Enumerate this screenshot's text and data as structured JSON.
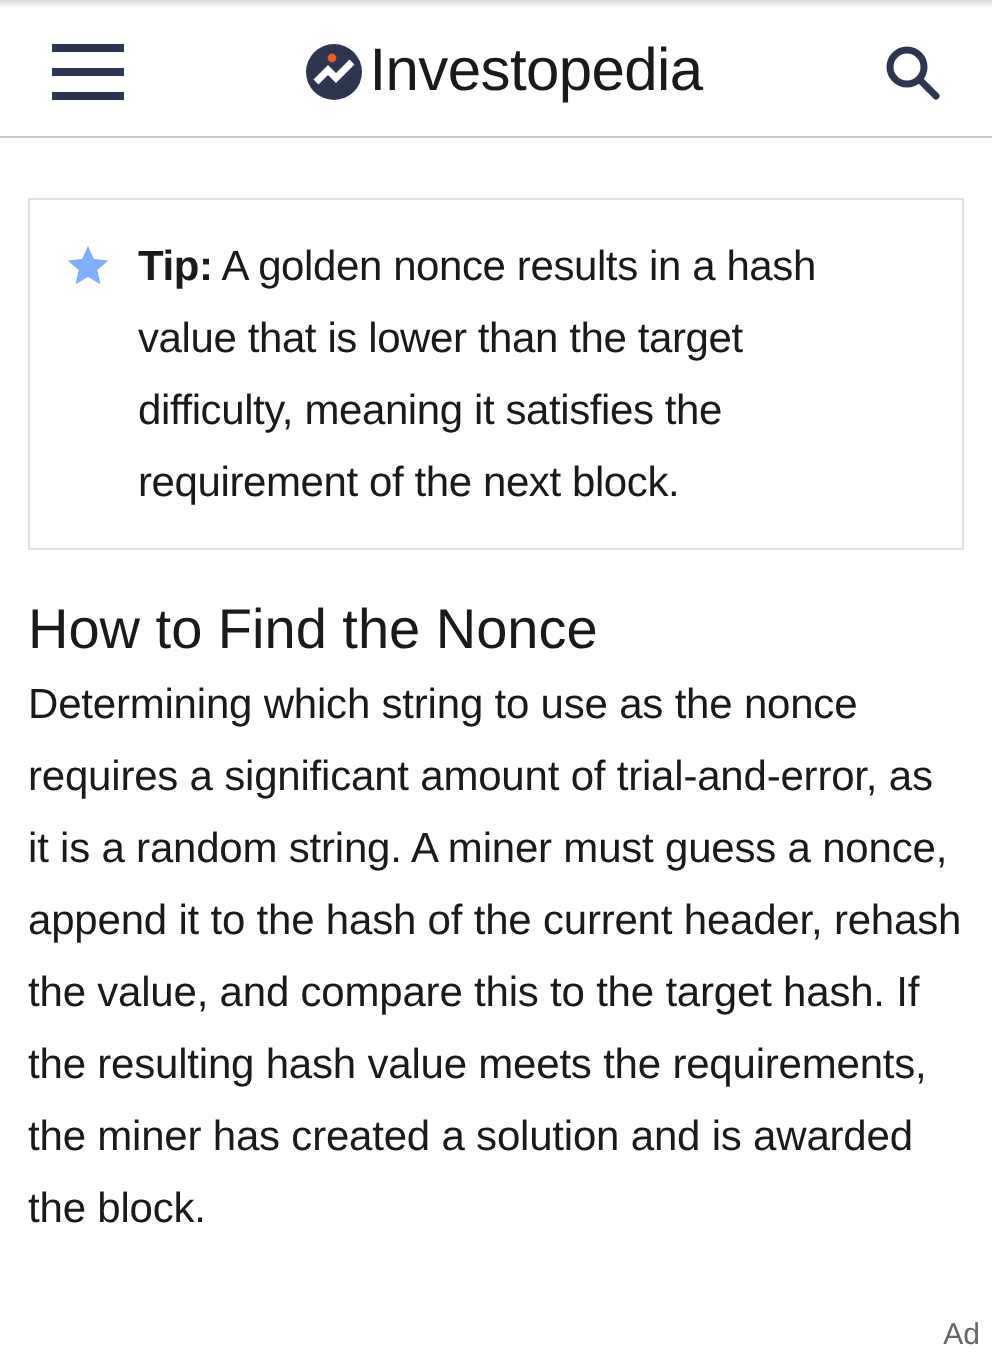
{
  "header": {
    "logo": "Investopedia"
  },
  "tip": {
    "text": "**Tip:**  A golden nonce results in a hash value that is lower than the target difficulty, meaning it satisfies the requirement of the next block."
  },
  "section": {
    "heading": "How to Find the Nonce",
    "paragraph": "Determining which string to use as the nonce requires a significant amount of trial-and-error, as it is a random string. A miner must guess a nonce, append it to the hash of the current header, rehash the value, and compare this to the target hash. If the resulting hash value meets the requirements, the miner has created a solution and is awarded the block."
  },
  "ad_label": "Ad"
}
